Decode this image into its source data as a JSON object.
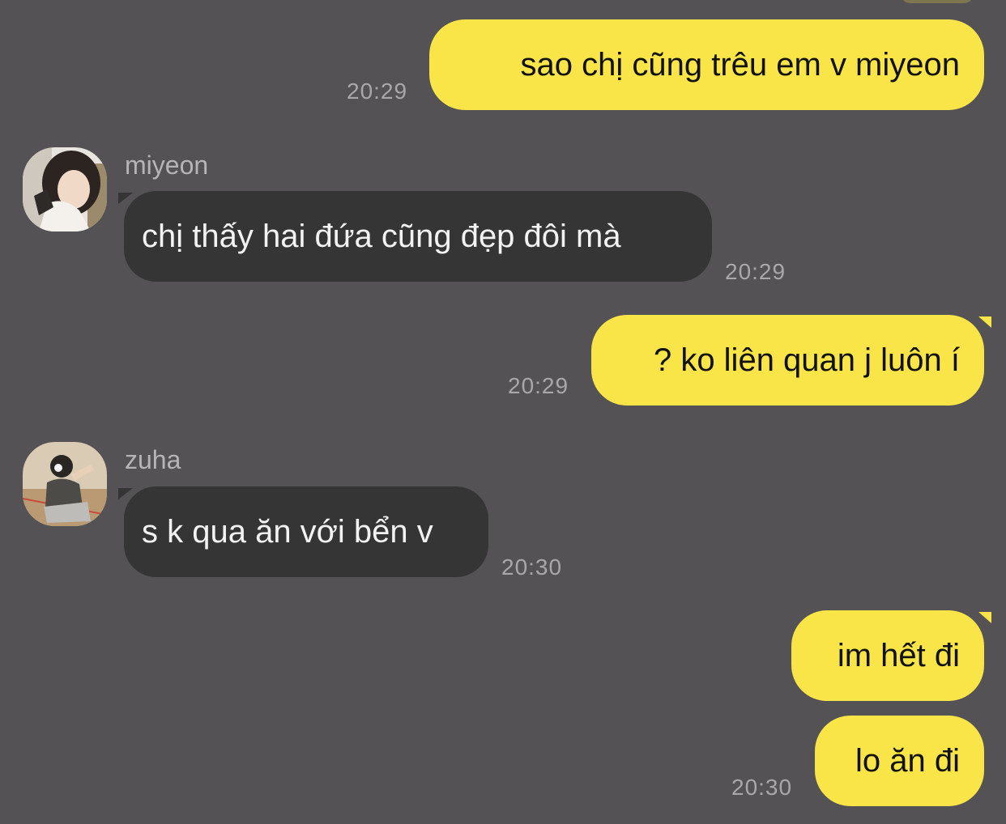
{
  "messages": [
    {
      "sender": "me",
      "text": "sao chị cũng trêu em v miyeon",
      "time": "20:29"
    },
    {
      "sender": "miyeon",
      "name": "miyeon",
      "text": "chị thấy hai đứa cũng đẹp đôi mà",
      "time": "20:29"
    },
    {
      "sender": "me",
      "text": "? ko liên quan j luôn í",
      "time": "20:29"
    },
    {
      "sender": "zuha",
      "name": "zuha",
      "text": "s k qua ăn với bển v",
      "time": "20:30"
    },
    {
      "sender": "me",
      "text": "im hết đi",
      "time": ""
    },
    {
      "sender": "me",
      "text": "lo ăn đi",
      "time": "20:30"
    }
  ],
  "colors": {
    "background": "#545254",
    "outgoing_bubble": "#f9e547",
    "incoming_bubble": "#363536",
    "timestamp": "#a9a8a9",
    "sender_name": "#b6b5b6"
  },
  "icons": {
    "avatar_miyeon": "profile-photo",
    "avatar_zuha": "profile-photo"
  }
}
